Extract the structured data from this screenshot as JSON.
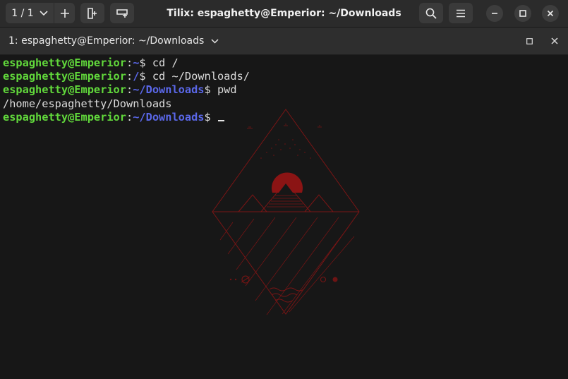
{
  "window": {
    "title": "Tilix: espaghetty@Emperior: ~/Downloads"
  },
  "header": {
    "session_counter": "1 / 1",
    "add_session_icon": "plus-icon",
    "split_right_icon": "split-right-icon",
    "split_down_icon": "split-down-icon",
    "search_icon": "search-icon",
    "menu_icon": "hamburger-menu-icon",
    "minimize_icon": "minimize-icon",
    "maximize_icon": "maximize-icon",
    "close_icon": "close-icon"
  },
  "terminal_bar": {
    "title": "1: espaghetty@Emperior: ~/Downloads",
    "dropdown_icon": "chevron-down-icon",
    "maximize_icon": "maximize-icon",
    "close_icon": "close-icon"
  },
  "terminal": {
    "lines": [
      {
        "type": "prompt",
        "user": "espaghetty@Emperior",
        "sep": ":",
        "path": "~",
        "dollar": "$",
        "command": " cd /"
      },
      {
        "type": "prompt",
        "user": "espaghetty@Emperior",
        "sep": ":",
        "path": "/",
        "dollar": "$",
        "command": " cd ~/Downloads/"
      },
      {
        "type": "prompt",
        "user": "espaghetty@Emperior",
        "sep": ":",
        "path": "~/Downloads",
        "dollar": "$",
        "command": " pwd"
      },
      {
        "type": "output",
        "text": "/home/espaghetty/Downloads"
      },
      {
        "type": "prompt",
        "user": "espaghetty@Emperior",
        "sep": ":",
        "path": "~/Downloads",
        "dollar": "$",
        "command": " "
      }
    ]
  },
  "colors": {
    "user": "#61d83b",
    "path": "#5a67e8",
    "text": "#dcdcdc",
    "background": "#171717",
    "wallpaper_accent": "#8b1414"
  }
}
